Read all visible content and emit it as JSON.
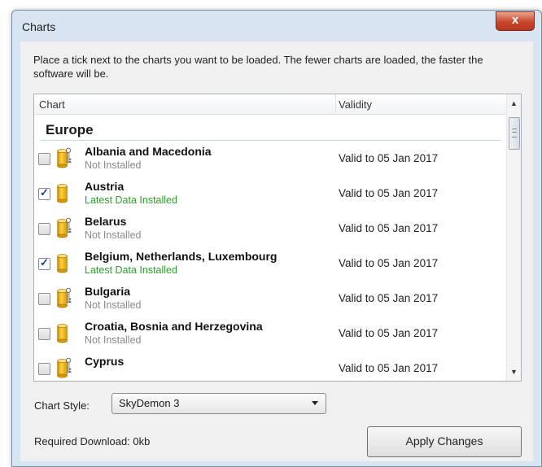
{
  "window": {
    "title": "Charts",
    "close_glyph": "x"
  },
  "instructions": "Place a tick next to the charts you want to be loaded. The fewer charts are loaded, the faster the software will be.",
  "list": {
    "columns": {
      "chart": "Chart",
      "validity": "Validity"
    },
    "group": "Europe",
    "rows": [
      {
        "name": "Albania and Macedonia",
        "status": "Not Installed",
        "validity": "Valid to 05 Jan 2017",
        "checked": false,
        "icon": "database-key-icon"
      },
      {
        "name": "Austria",
        "status": "Latest Data Installed",
        "validity": "Valid to 05 Jan 2017",
        "checked": true,
        "icon": "database-icon"
      },
      {
        "name": "Belarus",
        "status": "Not Installed",
        "validity": "Valid to 05 Jan 2017",
        "checked": false,
        "icon": "database-key-icon"
      },
      {
        "name": "Belgium, Netherlands, Luxembourg",
        "status": "Latest Data Installed",
        "validity": "Valid to 05 Jan 2017",
        "checked": true,
        "icon": "database-icon"
      },
      {
        "name": "Bulgaria",
        "status": "Not Installed",
        "validity": "Valid to 05 Jan 2017",
        "checked": false,
        "icon": "database-key-icon"
      },
      {
        "name": "Croatia, Bosnia and Herzegovina",
        "status": "Not Installed",
        "validity": "Valid to 05 Jan 2017",
        "checked": false,
        "icon": "database-icon"
      },
      {
        "name": "Cyprus",
        "status": "",
        "validity": "Valid to 05 Jan 2017",
        "checked": false,
        "icon": "database-key-icon"
      }
    ]
  },
  "chart_style": {
    "label": "Chart Style:",
    "value": "SkyDemon 3"
  },
  "required_download": "Required Download: 0kb",
  "apply_button": "Apply Changes",
  "colors": {
    "status_not_installed": "#8a8a8a",
    "status_latest": "#2e9e2e",
    "close_button": "#c8452c"
  }
}
